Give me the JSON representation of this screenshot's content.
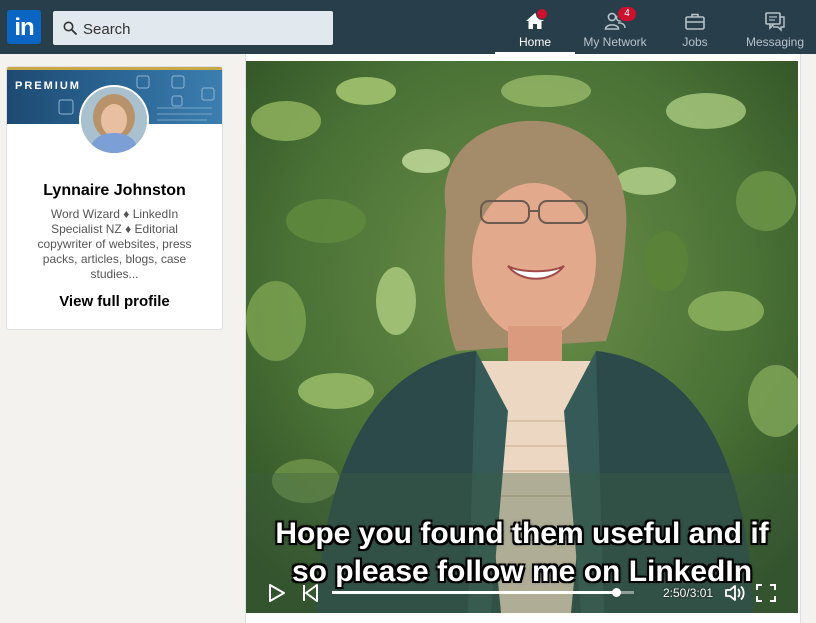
{
  "topbar": {
    "logo_text": "in",
    "search_placeholder": "Search",
    "nav": [
      {
        "label": "Home",
        "icon": "home-icon",
        "active": true,
        "badge": ""
      },
      {
        "label": "My Network",
        "icon": "people-icon",
        "active": false,
        "badge": "4"
      },
      {
        "label": "Jobs",
        "icon": "briefcase-icon",
        "active": false,
        "badge": ""
      },
      {
        "label": "Messaging",
        "icon": "chat-icon",
        "active": false,
        "badge": ""
      }
    ]
  },
  "profile": {
    "premium_label": "PREMIUM",
    "name": "Lynnaire Johnston",
    "headline": "Word Wizard ♦ LinkedIn Specialist NZ ♦ Editorial copywriter of websites, press packs, articles, blogs, case studies...",
    "view_profile": "View full profile"
  },
  "video": {
    "caption_line1": "Hope you found them useful and if",
    "caption_line2": "so please follow me on LinkedIn",
    "timecode": "2:50/3:01",
    "progress": 0.94
  },
  "colors": {
    "topbar": "#283e4a",
    "brand": "#0a66c2",
    "badge": "#cb112d"
  }
}
